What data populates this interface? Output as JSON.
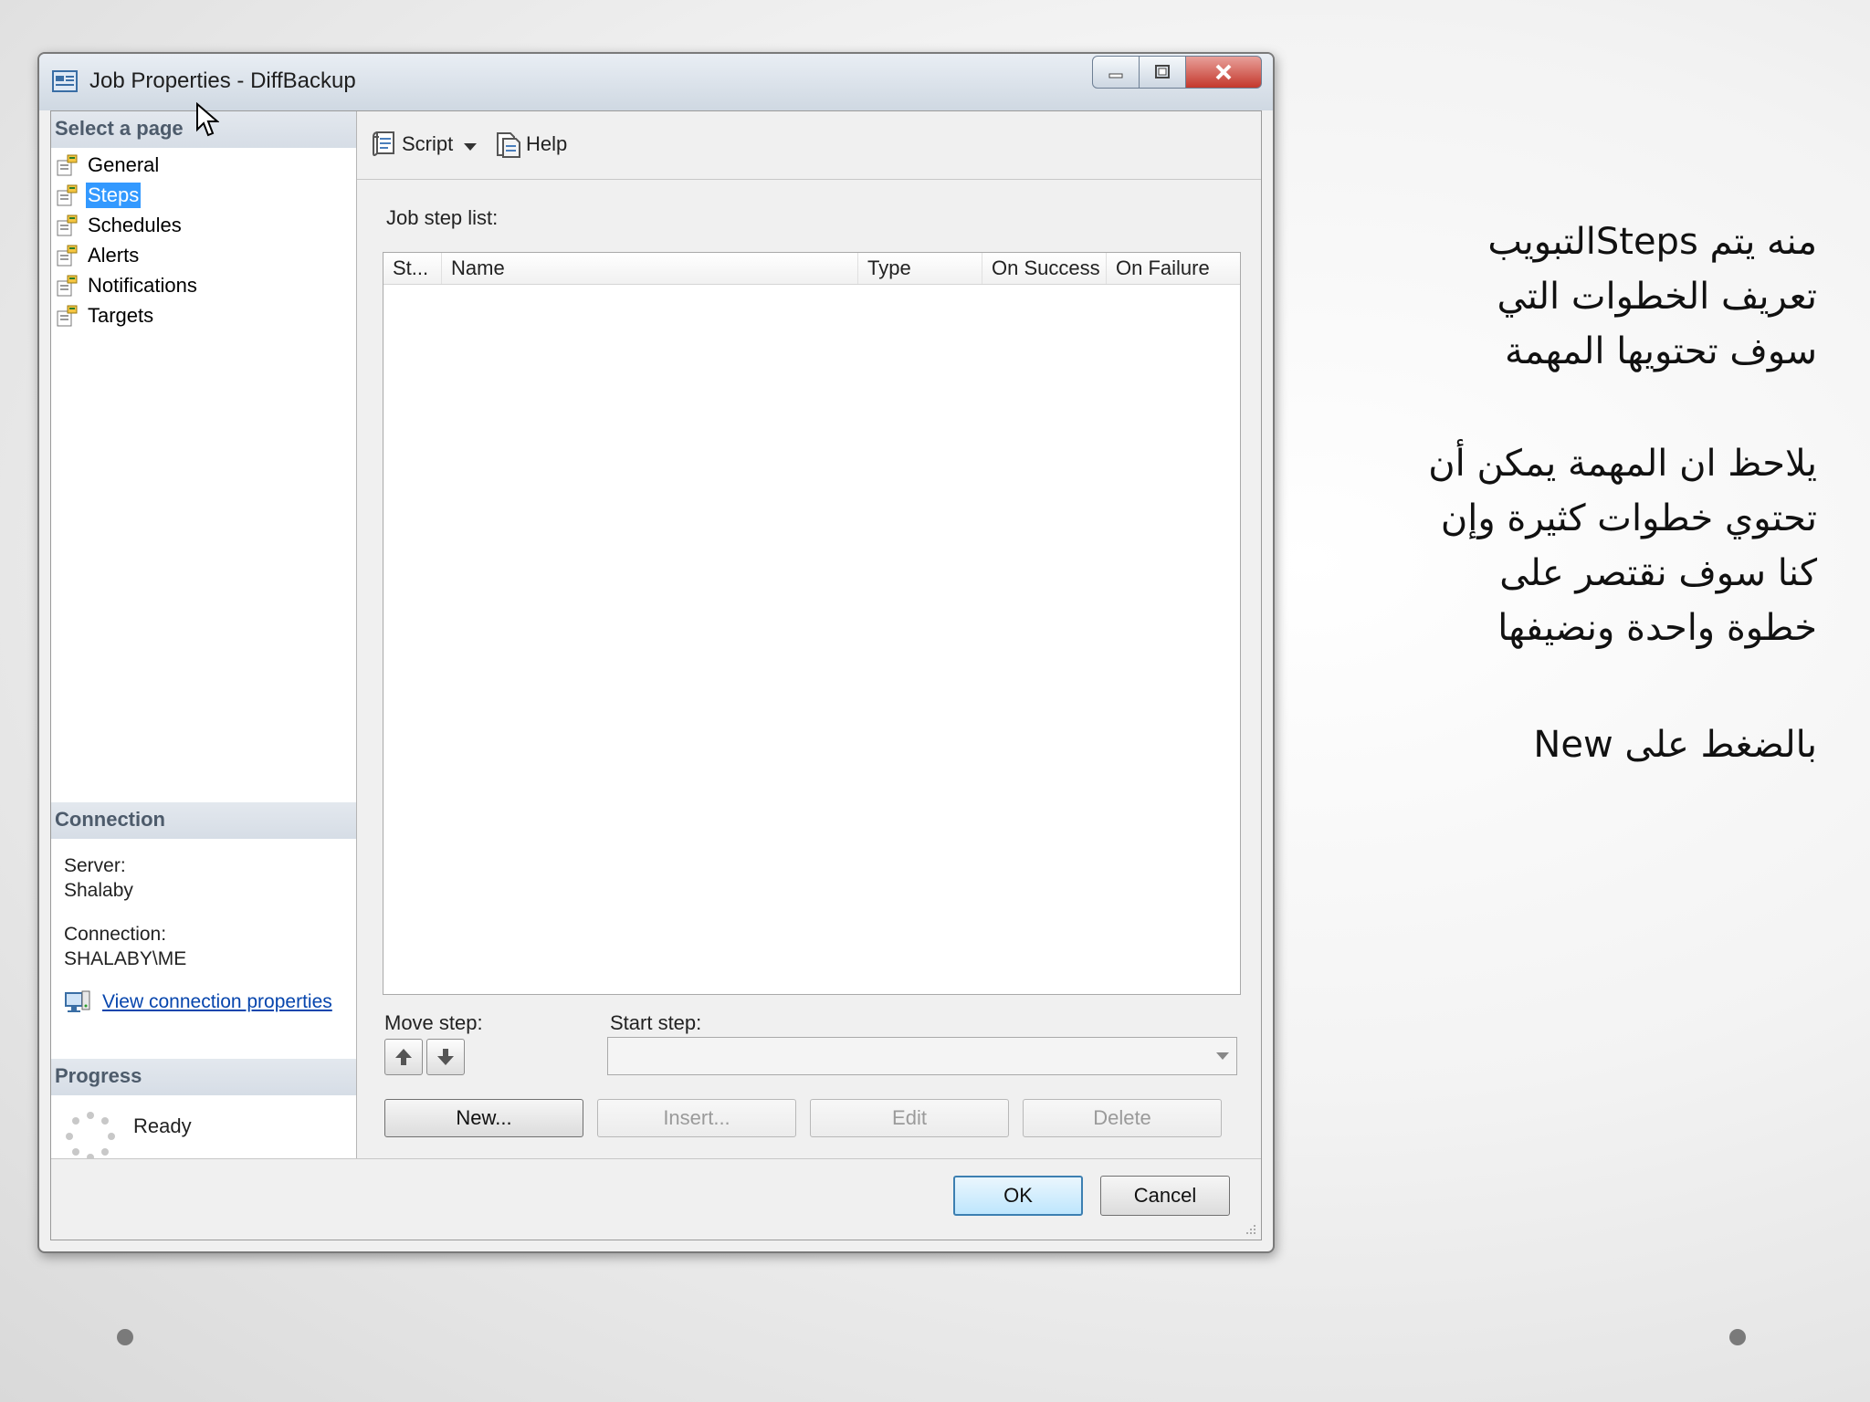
{
  "window": {
    "title": "Job Properties - DiffBackup",
    "controls": [
      "minimize",
      "maximize",
      "close"
    ]
  },
  "left_pane": {
    "select_page_header": "Select a page",
    "pages": [
      {
        "label": "General",
        "selected": false
      },
      {
        "label": "Steps",
        "selected": true
      },
      {
        "label": "Schedules",
        "selected": false
      },
      {
        "label": "Alerts",
        "selected": false
      },
      {
        "label": "Notifications",
        "selected": false
      },
      {
        "label": "Targets",
        "selected": false
      }
    ],
    "connection": {
      "header": "Connection",
      "server_label": "Server:",
      "server_value": "Shalaby",
      "connection_label": "Connection:",
      "connection_value": "SHALABY\\ME",
      "view_link": "View connection properties"
    },
    "progress": {
      "header": "Progress",
      "status": "Ready"
    }
  },
  "toolbar": {
    "script_label": "Script",
    "help_label": "Help"
  },
  "main": {
    "job_step_list_label": "Job step list:",
    "columns": [
      "St...",
      "Name",
      "Type",
      "On Success",
      "On Failure"
    ],
    "rows": [],
    "move_step_label": "Move step:",
    "start_step_label": "Start step:",
    "start_step_value": "",
    "buttons": {
      "new": "New...",
      "insert": "Insert...",
      "edit": "Edit",
      "delete": "Delete"
    }
  },
  "footer": {
    "ok": "OK",
    "cancel": "Cancel"
  },
  "slide_text": {
    "para1": [
      "منه يتم Stepsالتبويب",
      "تعريف الخطوات التي",
      "سوف تحتويها المهمة"
    ],
    "para2": [
      "يلاحظ ان المهمة يمكن أن",
      "تحتوي خطوات كثيرة وإن",
      "كنا سوف نقتصر على",
      "خطوة واحدة ونضيفها"
    ],
    "para3": [
      "بالضغط على New"
    ]
  },
  "colors": {
    "selection": "#3399ff",
    "section_header_text": "#4d5b6b",
    "link": "#0645ad",
    "close_button": "#c4382c"
  }
}
